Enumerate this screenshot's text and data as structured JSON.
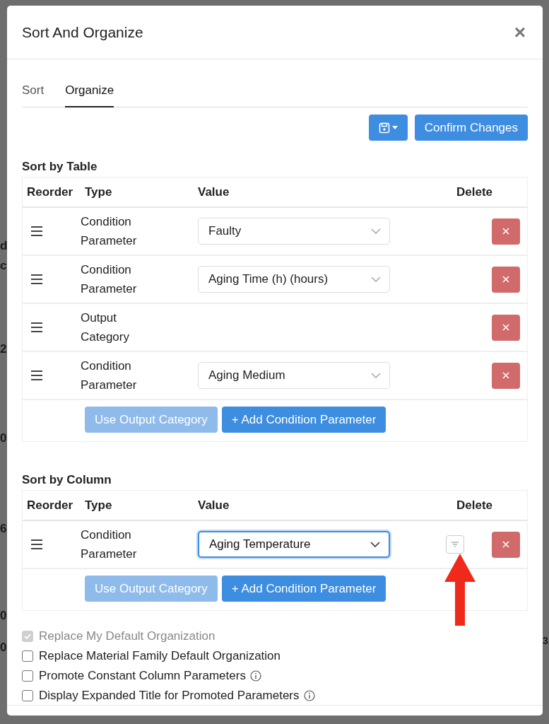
{
  "background_fragments": [
    "d",
    "c",
    "2",
    "0",
    "6",
    "0",
    "0"
  ],
  "right_fragment": "3",
  "dialog": {
    "title": "Sort And Organize",
    "close": "×"
  },
  "tabs": [
    {
      "label": "Sort",
      "selected": false
    },
    {
      "label": "Organize",
      "selected": true
    }
  ],
  "toolbar": {
    "confirm": "Confirm Changes"
  },
  "sections": [
    {
      "title": "Sort by Table",
      "columns": [
        "Reorder",
        "Type",
        "Value",
        "Delete"
      ],
      "rows": [
        {
          "type": "Condition Parameter",
          "value": "Faulty",
          "focused": false,
          "filter": false
        },
        {
          "type": "Condition Parameter",
          "value": "Aging Time (h) (hours)",
          "focused": false,
          "filter": false
        },
        {
          "type": "Output Category",
          "filter": false
        },
        {
          "type": "Condition Parameter",
          "value": "Aging Medium",
          "focused": false,
          "filter": false
        }
      ],
      "buttons": [
        {
          "label": "Use Output Category",
          "disabled": true
        },
        {
          "label": "+ Add Condition Parameter",
          "disabled": false
        }
      ]
    },
    {
      "title": "Sort by Column",
      "columns": [
        "Reorder",
        "Type",
        "Value",
        "Delete"
      ],
      "rows": [
        {
          "type": "Condition Parameter",
          "value": "Aging Temperature",
          "focused": true,
          "filter": true
        }
      ],
      "buttons": [
        {
          "label": "Use Output Category",
          "disabled": true
        },
        {
          "label": "+ Add Condition Parameter",
          "disabled": false
        }
      ]
    }
  ],
  "options": [
    {
      "label": "Replace My Default Organization",
      "checked": true,
      "disabled": true,
      "info": false
    },
    {
      "label": "Replace Material Family Default Organization",
      "checked": false,
      "disabled": false,
      "info": false
    },
    {
      "label": "Promote Constant Column Parameters",
      "checked": false,
      "disabled": false,
      "info": true
    },
    {
      "label": "Display Expanded Title for Promoted Parameters",
      "checked": false,
      "disabled": false,
      "info": true
    }
  ]
}
